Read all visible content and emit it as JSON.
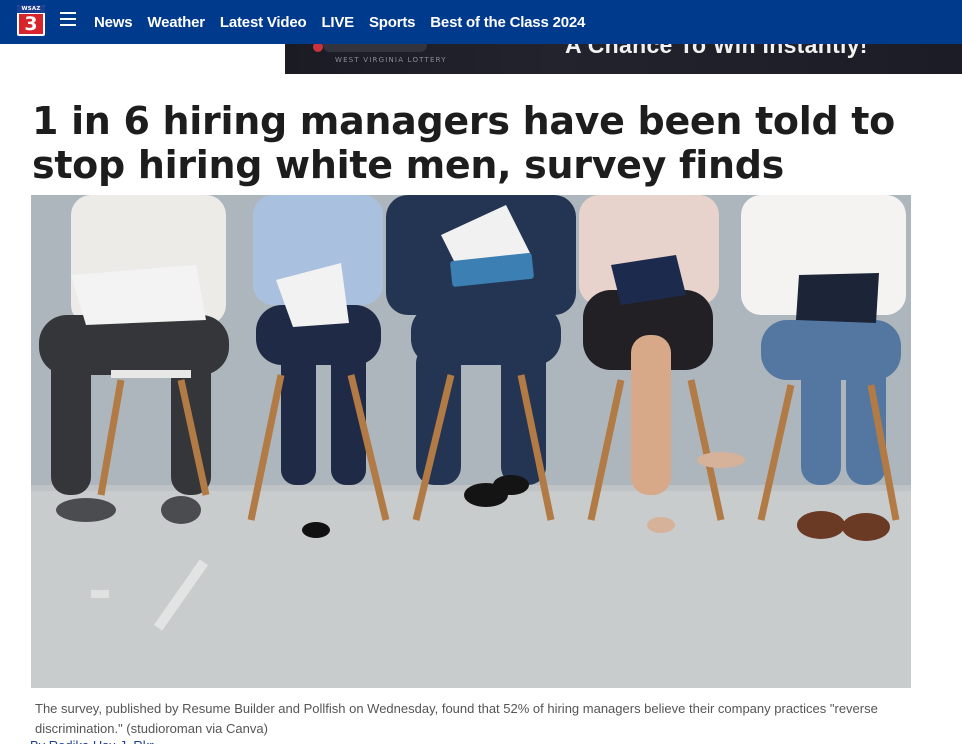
{
  "header": {
    "logo": {
      "station": "WSAZ",
      "number": "3"
    },
    "menu_icon": "hamburger-menu-icon",
    "nav": [
      "News",
      "Weather",
      "Latest Video",
      "LIVE",
      "Sports",
      "Best of the Class 2024"
    ]
  },
  "ad": {
    "sponsor_sub": "WEST VIRGINIA LOTTERY",
    "headline": "A Chance To Win Instantly!"
  },
  "article": {
    "headline": "1 in 6 hiring managers have been told to stop hiring white men, survey finds",
    "photo": {
      "description_icon": "article-photo",
      "caption": "The survey, published by Resume Builder and Pollfish on Wednesday, found that 52% of hiring managers believe their company practices \"reverse discrimination.\" (studioroman via Canva)"
    },
    "byline_fragment": "By Rodika Hsu J. Rkr"
  },
  "colors": {
    "nav_bg": "#003a8c",
    "logo_red": "#d8252c",
    "headline_text": "#1d1d1d",
    "caption_text": "#555555"
  }
}
